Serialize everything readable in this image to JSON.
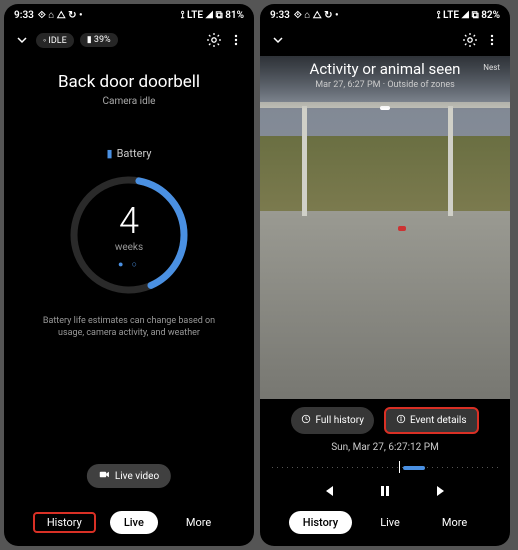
{
  "left": {
    "status": {
      "time": "9:33",
      "icons": "⟐ ⌂ △ ↻ •",
      "network": "⟟ LTE ◢ ⧉ 81%"
    },
    "topbar": {
      "idle_pill": "◦ IDLE",
      "battery_pill": "▮ 39%"
    },
    "title": "Back door doorbell",
    "subtitle": "Camera idle",
    "battery": {
      "label": "Battery",
      "value": "4",
      "unit": "weeks"
    },
    "disclaimer": "Battery life estimates can change based on usage, camera activity, and weather",
    "live_video": "Live video",
    "tabs": {
      "history": "History",
      "live": "Live",
      "more": "More"
    }
  },
  "right": {
    "status": {
      "time": "9:33",
      "icons": "⟐ ⌂ △ ↻ •",
      "network": "⟟ LTE ◢ ⧉ 82%"
    },
    "event": {
      "title": "Activity or animal seen",
      "sub": "Mar 27, 6:27 PM · Outside of zones",
      "brand": "Nest"
    },
    "actions": {
      "full_history": "Full history",
      "event_details": "Event details"
    },
    "timestamp": "Sun, Mar 27, 6:27:12 PM",
    "tabs": {
      "history": "History",
      "live": "Live",
      "more": "More"
    }
  }
}
